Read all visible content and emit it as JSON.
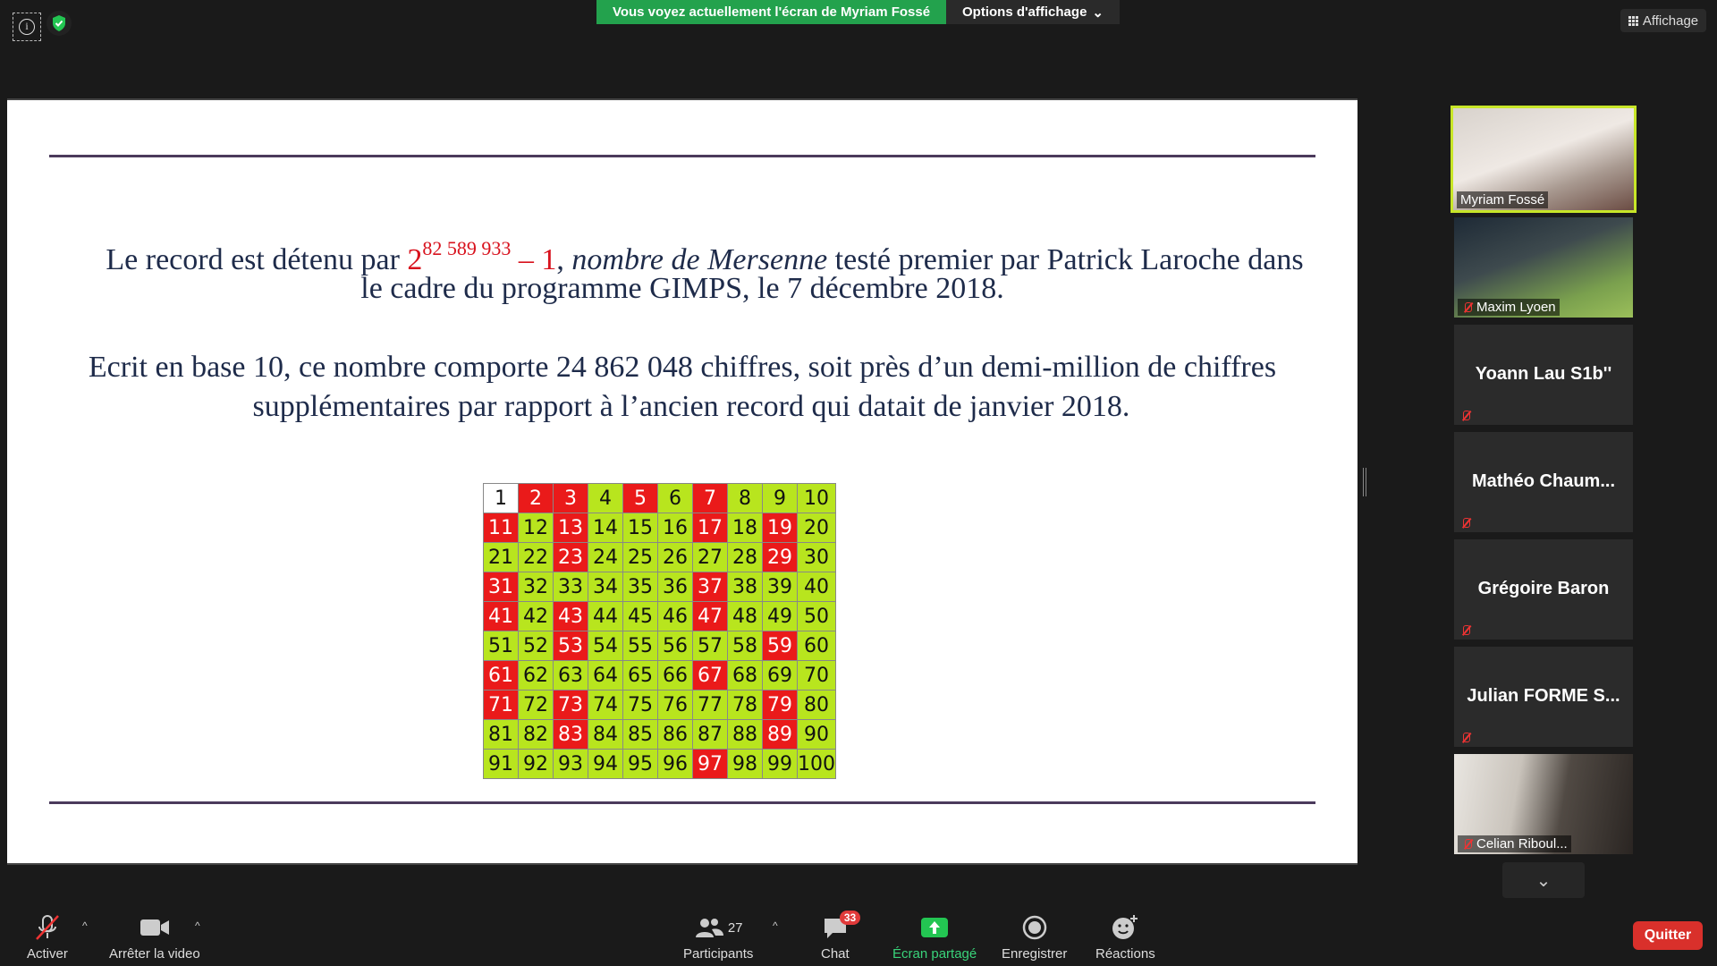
{
  "topbar": {
    "viewing_banner": "Vous voyez actuellement l'écran de Myriam Fossé",
    "view_options": "Options d'affichage",
    "view_options_caret": "⌄",
    "affichage": "Affichage",
    "info_glyph": "i"
  },
  "slide": {
    "line1_a": "Le record est détenu par ",
    "line1_base": "2",
    "line1_exp": "82 589 933",
    "line1_minus": " – 1",
    "line1_comma": ", ",
    "line1_italic": "nombre de Mersenne",
    "line1_b": " testé premier par Patrick Laroche dans",
    "line2": "le cadre du programme GIMPS, le 7 décembre 2018.",
    "line3": "Ecrit en base 10, ce nombre comporte  24 862 048 chiffres, soit près d’un demi-million de chiffres",
    "line4": "supplémentaires par rapport à l’ancien record qui datait de janvier 2018."
  },
  "prime_table": {
    "primes": [
      2,
      3,
      5,
      7,
      11,
      13,
      17,
      19,
      23,
      29,
      31,
      37,
      41,
      43,
      47,
      53,
      59,
      61,
      67,
      71,
      73,
      79,
      83,
      89,
      97
    ],
    "colors": {
      "prime": "#ea1a1a",
      "composite": "#b8e51e",
      "one": "#ffffff"
    }
  },
  "participants": [
    {
      "name": "Myriam Fossé",
      "video": true,
      "active": true,
      "muted": false
    },
    {
      "name": "Maxim Lyoen",
      "video": true,
      "active": false,
      "muted": true
    },
    {
      "name": "Yoann Lau S1b''",
      "video": false,
      "active": false,
      "muted": true
    },
    {
      "name": "Mathéo  Chaum...",
      "video": false,
      "active": false,
      "muted": true
    },
    {
      "name": "Grégoire Baron",
      "video": false,
      "active": false,
      "muted": true
    },
    {
      "name": "Julian  FORME  S...",
      "video": false,
      "active": false,
      "muted": true
    },
    {
      "name": "Celian Riboul...",
      "video": true,
      "active": false,
      "muted": true
    }
  ],
  "toolbar": {
    "mute_label": "Activer",
    "video_label": "Arrêter la video",
    "participants_label": "Participants",
    "participants_count": "27",
    "chat_label": "Chat",
    "chat_badge": "33",
    "share_label": "Écran partagé",
    "record_label": "Enregistrer",
    "reactions_label": "Réactions",
    "quit_label": "Quitter",
    "caret": "^",
    "scroll_down": "⌄"
  },
  "colors": {
    "share_green": "#23a24d",
    "active_speaker": "#c8e628",
    "quit_red": "#d9302b"
  }
}
